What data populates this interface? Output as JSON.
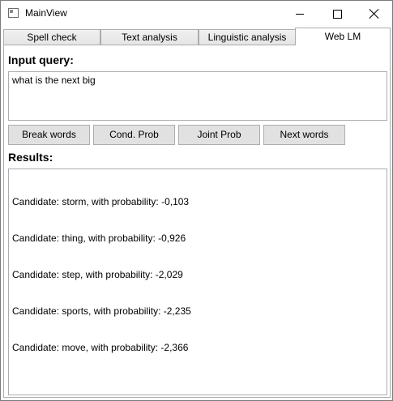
{
  "window": {
    "title": "MainView"
  },
  "tabs": [
    {
      "label": "Spell check"
    },
    {
      "label": "Text analysis"
    },
    {
      "label": "Linguistic analysis"
    },
    {
      "label": "Web LM"
    }
  ],
  "active_tab": "Web LM",
  "input": {
    "heading": "Input query:",
    "value": "what is the next big"
  },
  "buttons": [
    {
      "label": "Break words"
    },
    {
      "label": "Cond. Prob"
    },
    {
      "label": "Joint Prob"
    },
    {
      "label": "Next words"
    }
  ],
  "results": {
    "heading": "Results:",
    "lines": [
      "Candidate: storm, with probability: -0,103",
      "Candidate: thing, with probability: -0,926",
      "Candidate: step, with probability: -2,029",
      "Candidate: sports, with probability: -2,235",
      "Candidate: move, with probability: -2,366"
    ]
  }
}
